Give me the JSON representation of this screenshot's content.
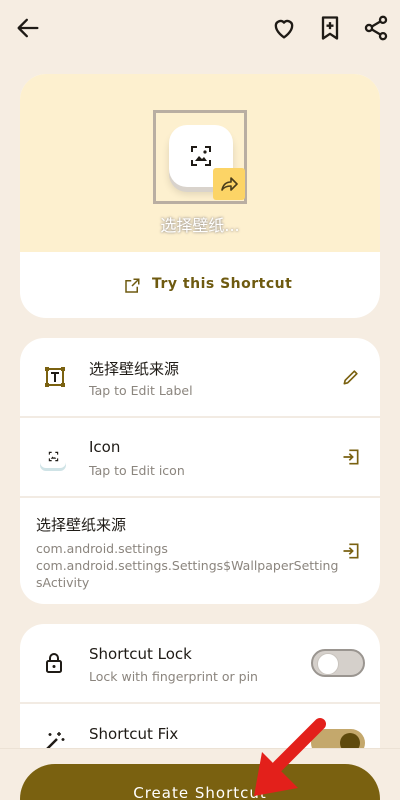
{
  "colors": {
    "accent": "#7a6110",
    "hero_bg": "#fdf0cf",
    "page_bg": "#f6ede2",
    "arrow": "#e3201b"
  },
  "top_bar": {
    "icons": [
      "back-arrow-icon",
      "heart-icon",
      "bookmark-add-icon",
      "share-icon"
    ]
  },
  "hero": {
    "title": "选择壁纸...",
    "try_label": "Try this Shortcut"
  },
  "details": [
    {
      "title": "选择壁纸来源",
      "subtitle": "Tap to Edit Label",
      "icon": "text-frame-icon",
      "action_icon": "pencil-icon"
    },
    {
      "title": "Icon",
      "subtitle": "Tap to Edit icon",
      "icon": "wallpaper-icon",
      "action_icon": "open-in-icon"
    },
    {
      "title": "选择壁纸来源",
      "subtitle_lines": [
        "com.android.settings",
        "com.android.settings.Settings$WallpaperSetting",
        "sActivity"
      ],
      "action_icon": "open-in-icon"
    }
  ],
  "options": [
    {
      "title": "Shortcut Lock",
      "subtitle": "Lock with fingerprint or pin",
      "icon": "lock-icon",
      "toggle": false
    },
    {
      "title": "Shortcut Fix",
      "icon": "magic-wand-icon",
      "toggle": true
    }
  ],
  "create_button": {
    "label": "Create Shortcut"
  }
}
